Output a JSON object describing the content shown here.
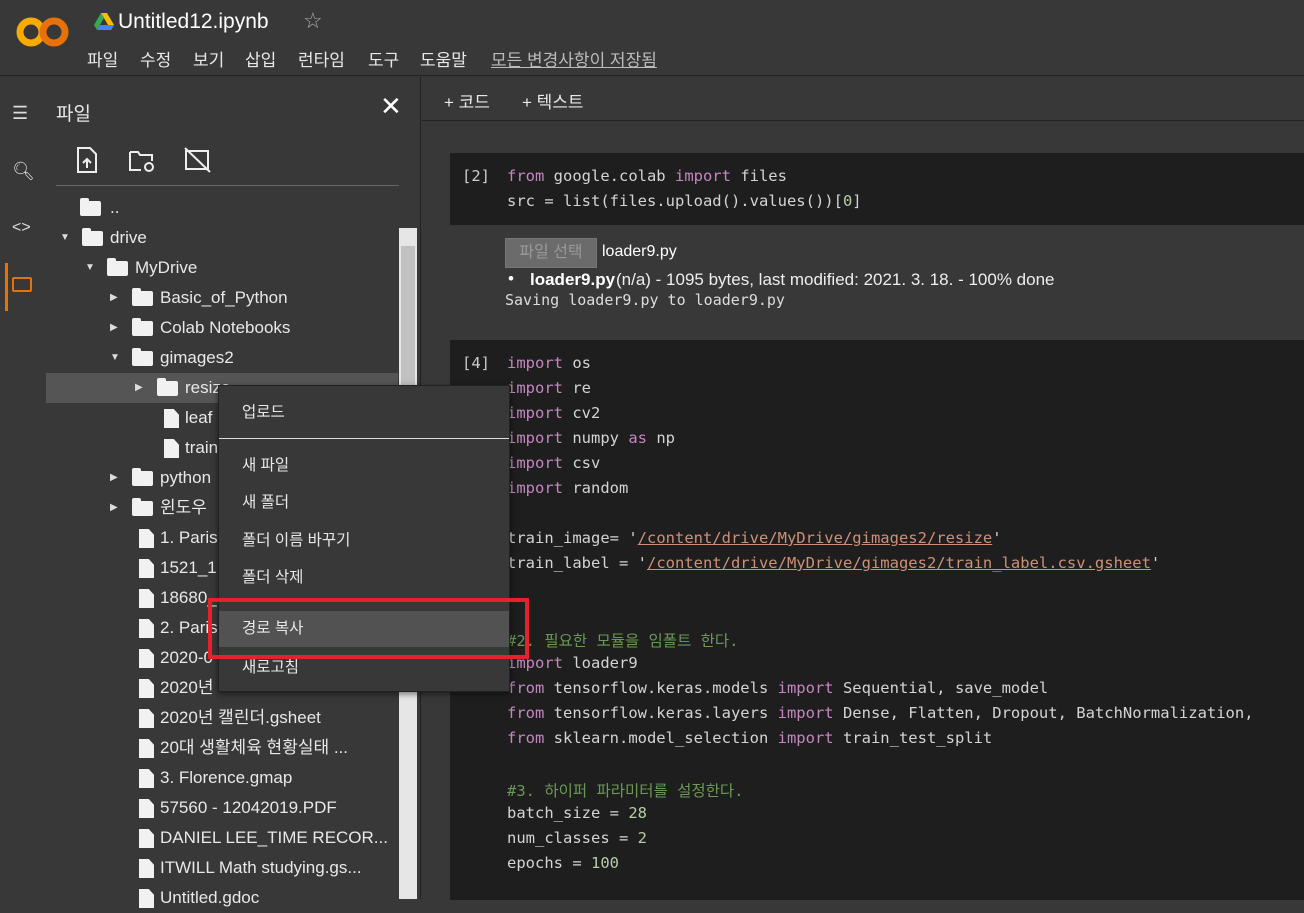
{
  "header": {
    "title": "Untitled12.ipynb",
    "logo": "CO",
    "menus": [
      "파일",
      "수정",
      "보기",
      "삽입",
      "런타임",
      "도구",
      "도움말"
    ],
    "saved_status": "모든 변경사항이 저장됨"
  },
  "panel": {
    "title": "파일"
  },
  "tree": [
    {
      "label": "..",
      "type": "up",
      "depth": 0
    },
    {
      "label": "drive",
      "type": "folder",
      "depth": 0,
      "open": true
    },
    {
      "label": "MyDrive",
      "type": "folder",
      "depth": 1,
      "open": true
    },
    {
      "label": "Basic_of_Python",
      "type": "folder",
      "depth": 2
    },
    {
      "label": "Colab Notebooks",
      "type": "folder",
      "depth": 2
    },
    {
      "label": "gimages2",
      "type": "folder",
      "depth": 2,
      "open": true
    },
    {
      "label": "resize",
      "type": "folder",
      "depth": 3,
      "selected": true
    },
    {
      "label": "leaf",
      "type": "file",
      "depth": 3
    },
    {
      "label": "train",
      "type": "file",
      "depth": 3
    },
    {
      "label": "python",
      "type": "folder",
      "depth": 2
    },
    {
      "label": "윈도우",
      "type": "folder",
      "depth": 2
    },
    {
      "label": "1. Paris",
      "type": "file",
      "depth": 2
    },
    {
      "label": "1521_1",
      "type": "file",
      "depth": 2
    },
    {
      "label": "18680_",
      "type": "file",
      "depth": 2
    },
    {
      "label": "2. Paris",
      "type": "file",
      "depth": 2
    },
    {
      "label": "2020-0",
      "type": "file",
      "depth": 2
    },
    {
      "label": "2020년",
      "type": "file",
      "depth": 2
    },
    {
      "label": "2020년 캘린더.gsheet",
      "type": "file",
      "depth": 2
    },
    {
      "label": "20대 생활체육 현황실태 ...",
      "type": "file",
      "depth": 2
    },
    {
      "label": "3. Florence.gmap",
      "type": "file",
      "depth": 2
    },
    {
      "label": "57560 - 12042019.PDF",
      "type": "file",
      "depth": 2
    },
    {
      "label": "DANIEL LEE_TIME RECOR...",
      "type": "file",
      "depth": 2
    },
    {
      "label": "ITWILL Math studying.gs...",
      "type": "file",
      "depth": 2
    },
    {
      "label": "Untitled.gdoc",
      "type": "file",
      "depth": 2
    }
  ],
  "toolbar": {
    "add_code": "+ 코드",
    "add_text": "+ 텍스트"
  },
  "cells": [
    {
      "prompt": "[2]",
      "lines": [
        [
          [
            "from",
            "kw"
          ],
          [
            " google.colab ",
            ""
          ],
          [
            "import",
            "kw"
          ],
          [
            " files",
            ""
          ]
        ],
        [
          [
            "src = list(files.upload().values())[",
            ""
          ],
          [
            "0",
            "num"
          ],
          [
            "]",
            ""
          ]
        ]
      ]
    },
    {
      "prompt": "[4]",
      "lines": [
        [
          [
            "import",
            "kw"
          ],
          [
            " os",
            ""
          ]
        ],
        [
          [
            "import",
            "kw"
          ],
          [
            " re",
            ""
          ]
        ],
        [
          [
            "import",
            "kw"
          ],
          [
            " cv2",
            ""
          ]
        ],
        [
          [
            "import",
            "kw"
          ],
          [
            " numpy ",
            ""
          ],
          [
            "as",
            "kw"
          ],
          [
            " np",
            ""
          ]
        ],
        [
          [
            "import",
            "kw"
          ],
          [
            " csv",
            ""
          ]
        ],
        [
          [
            "import",
            "kw"
          ],
          [
            " random",
            ""
          ]
        ],
        [],
        [
          [
            "train_image= '",
            ""
          ],
          [
            "/content/drive/MyDrive/gimages2/resize",
            "str"
          ],
          [
            "'",
            ""
          ]
        ],
        [
          [
            "train_label = '",
            ""
          ],
          [
            "/content/drive/MyDrive/gimages2/train_label.csv.gsheet",
            "str"
          ],
          [
            "'",
            ""
          ]
        ],
        [],
        [],
        [
          [
            "#2. 필요한 모듈을 임폴트 한다.",
            "cm"
          ]
        ],
        [
          [
            "import",
            "kw"
          ],
          [
            " loader9",
            ""
          ]
        ],
        [
          [
            "from",
            "kw"
          ],
          [
            " tensorflow.keras.models ",
            ""
          ],
          [
            "import",
            "kw"
          ],
          [
            " Sequential, save_model",
            ""
          ]
        ],
        [
          [
            "from",
            "kw"
          ],
          [
            " tensorflow.keras.layers ",
            ""
          ],
          [
            "import",
            "kw"
          ],
          [
            " Dense, Flatten, Dropout, BatchNormalization,",
            ""
          ]
        ],
        [
          [
            "from",
            "kw"
          ],
          [
            " sklearn.model_selection ",
            ""
          ],
          [
            "import",
            "kw"
          ],
          [
            " train_test_split",
            ""
          ]
        ],
        [],
        [
          [
            "#3. 하이퍼 파라미터를 설정한다.",
            "cm"
          ]
        ],
        [
          [
            "batch_size = ",
            ""
          ],
          [
            "28",
            "num"
          ]
        ],
        [
          [
            "num_classes = ",
            ""
          ],
          [
            "2",
            "num"
          ]
        ],
        [
          [
            "epochs = ",
            ""
          ],
          [
            "100",
            "num"
          ]
        ]
      ]
    }
  ],
  "output": {
    "choose_button": "파일 선택",
    "chosen_file": "loader9.py",
    "file_name": "loader9.py",
    "file_info": "(n/a) - 1095 bytes, last modified: 2021. 3. 18. - 100% done",
    "saving": "Saving loader9.py to loader9.py"
  },
  "context_menu": [
    "업로드",
    "새 파일",
    "새 폴더",
    "폴더 이름 바꾸기",
    "폴더 삭제",
    "경로 복사",
    "새로고침"
  ],
  "colors": {
    "highlight": "#e8202a",
    "logo_orange": "#f9ab00"
  }
}
